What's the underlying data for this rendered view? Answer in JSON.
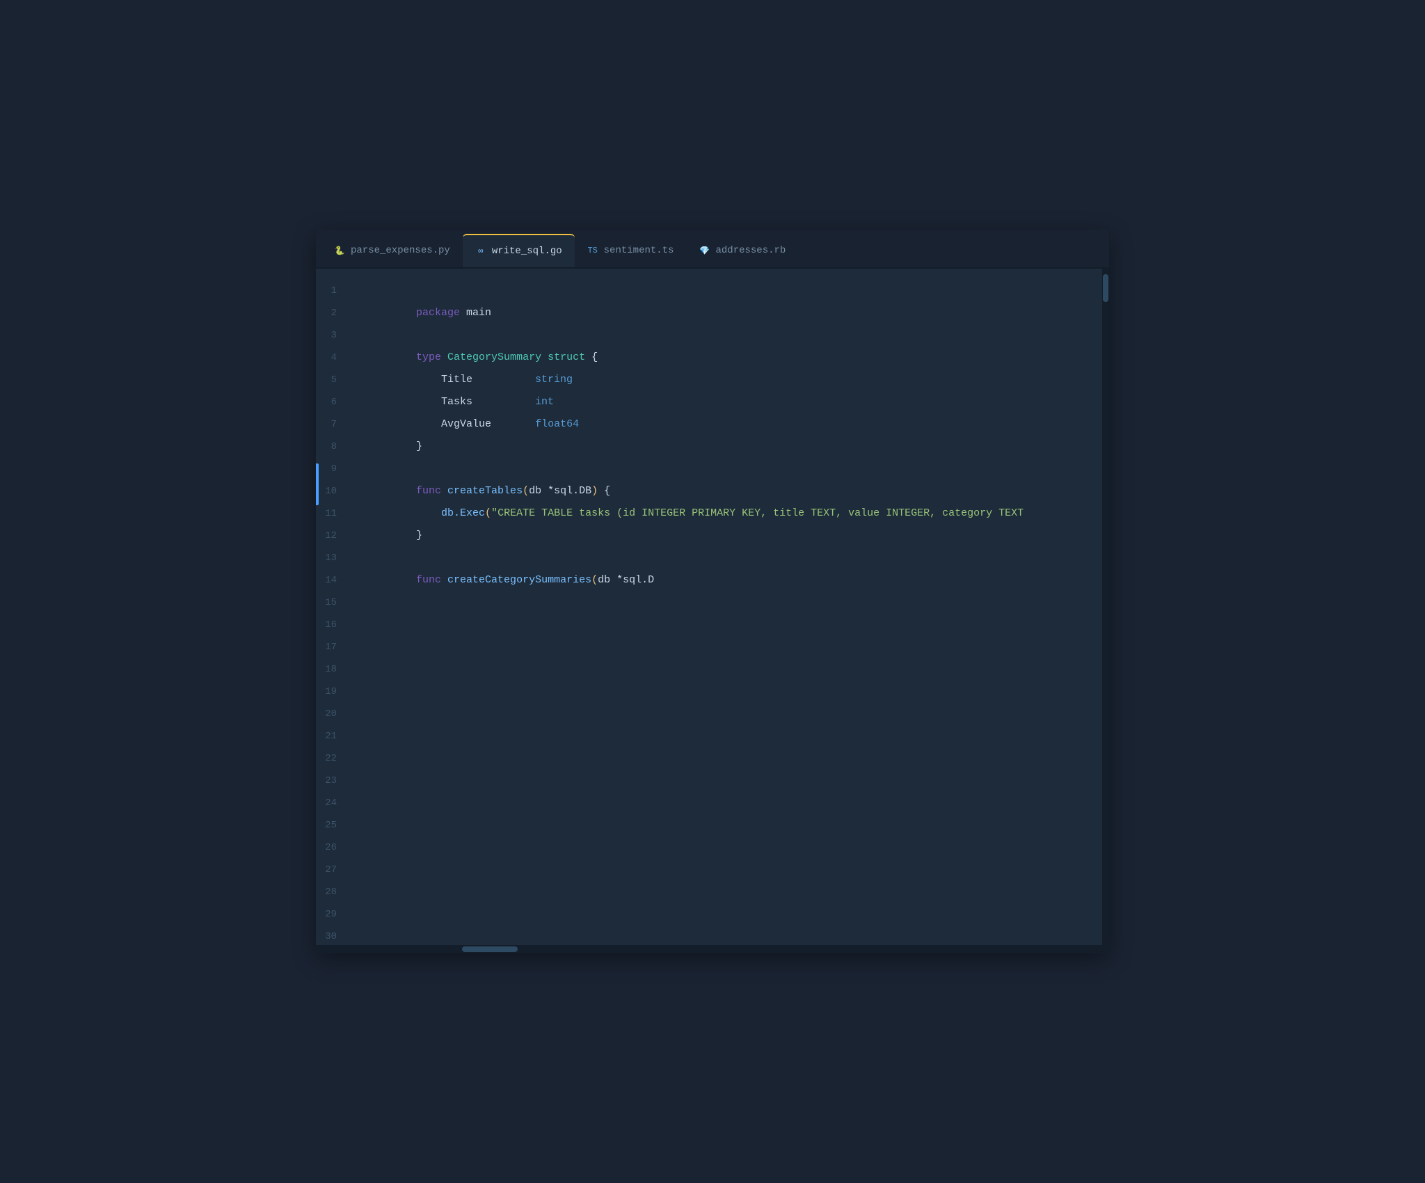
{
  "tabs": [
    {
      "id": "tab-parse",
      "label": "parse_expenses.py",
      "lang": "py",
      "active": false
    },
    {
      "id": "tab-write",
      "label": "write_sql.go",
      "lang": "go",
      "active": true
    },
    {
      "id": "tab-sentiment",
      "label": "sentiment.ts",
      "lang": "ts",
      "active": false
    },
    {
      "id": "tab-addresses",
      "label": "addresses.rb",
      "lang": "rb",
      "active": false
    }
  ],
  "code_lines": [
    {
      "num": "1",
      "tokens": [
        {
          "t": "kw-package",
          "v": "package"
        },
        {
          "t": "identifier",
          "v": " main"
        }
      ]
    },
    {
      "num": "2",
      "tokens": []
    },
    {
      "num": "3",
      "tokens": [
        {
          "t": "kw-type",
          "v": "type"
        },
        {
          "t": "identifier",
          "v": " "
        },
        {
          "t": "type-name",
          "v": "CategorySummary"
        },
        {
          "t": "identifier",
          "v": " "
        },
        {
          "t": "kw-struct",
          "v": "struct"
        },
        {
          "t": "punctuation",
          "v": " {"
        }
      ]
    },
    {
      "num": "4",
      "tokens": [
        {
          "t": "indent",
          "v": "    "
        },
        {
          "t": "field-name",
          "v": "Title"
        },
        {
          "t": "indent",
          "v": "          "
        },
        {
          "t": "builtin-type",
          "v": "string"
        }
      ]
    },
    {
      "num": "5",
      "tokens": [
        {
          "t": "indent",
          "v": "    "
        },
        {
          "t": "field-name",
          "v": "Tasks"
        },
        {
          "t": "indent",
          "v": "          "
        },
        {
          "t": "builtin-type",
          "v": "int"
        }
      ]
    },
    {
      "num": "6",
      "tokens": [
        {
          "t": "indent",
          "v": "    "
        },
        {
          "t": "field-name",
          "v": "AvgValue"
        },
        {
          "t": "indent",
          "v": "       "
        },
        {
          "t": "builtin-type",
          "v": "float64"
        }
      ]
    },
    {
      "num": "7",
      "tokens": [
        {
          "t": "brace",
          "v": "}"
        }
      ]
    },
    {
      "num": "8",
      "tokens": []
    },
    {
      "num": "9",
      "tokens": [
        {
          "t": "kw-package",
          "v": "func"
        },
        {
          "t": "identifier",
          "v": " "
        },
        {
          "t": "func-name",
          "v": "createTables"
        },
        {
          "t": "paren",
          "v": "("
        },
        {
          "t": "param",
          "v": "db *sql.DB"
        },
        {
          "t": "paren",
          "v": ")"
        },
        {
          "t": "identifier",
          "v": " {"
        }
      ]
    },
    {
      "num": "10",
      "tokens": [
        {
          "t": "indent",
          "v": "    "
        },
        {
          "t": "method-call",
          "v": "db.Exec"
        },
        {
          "t": "paren",
          "v": "("
        },
        {
          "t": "sql-string",
          "v": "\"CREATE TABLE tasks (id INTEGER PRIMARY KEY, title TEXT, value INTEGER, category TEXT"
        },
        {
          "t": "dots",
          "v": "…"
        }
      ]
    },
    {
      "num": "11",
      "tokens": [
        {
          "t": "brace",
          "v": "}"
        }
      ]
    },
    {
      "num": "12",
      "tokens": []
    },
    {
      "num": "13",
      "tokens": [
        {
          "t": "kw-package",
          "v": "func"
        },
        {
          "t": "identifier",
          "v": " "
        },
        {
          "t": "func-name",
          "v": "createCategorySummaries"
        },
        {
          "t": "paren",
          "v": "("
        },
        {
          "t": "param",
          "v": "db *sql.D"
        }
      ]
    },
    {
      "num": "14",
      "tokens": []
    },
    {
      "num": "15",
      "tokens": []
    },
    {
      "num": "16",
      "tokens": []
    },
    {
      "num": "17",
      "tokens": []
    },
    {
      "num": "18",
      "tokens": []
    },
    {
      "num": "19",
      "tokens": []
    },
    {
      "num": "20",
      "tokens": []
    },
    {
      "num": "21",
      "tokens": []
    },
    {
      "num": "22",
      "tokens": []
    },
    {
      "num": "23",
      "tokens": []
    },
    {
      "num": "24",
      "tokens": []
    },
    {
      "num": "25",
      "tokens": []
    },
    {
      "num": "26",
      "tokens": []
    },
    {
      "num": "27",
      "tokens": []
    },
    {
      "num": "28",
      "tokens": []
    },
    {
      "num": "29",
      "tokens": []
    },
    {
      "num": "30",
      "tokens": []
    }
  ]
}
